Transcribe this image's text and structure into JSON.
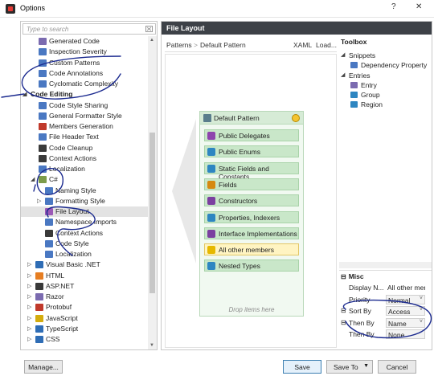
{
  "window": {
    "title": "Options",
    "help_btn": "?",
    "close_btn": "✕"
  },
  "search": {
    "placeholder": "Type to search"
  },
  "tree": [
    {
      "label": "Generated Code",
      "color": "#7b6bb0"
    },
    {
      "label": "Inspection Severity",
      "color": "#4a78c2"
    },
    {
      "label": "Custom Patterns",
      "color": "#4a78c2"
    },
    {
      "label": "Code Annotations",
      "color": "#4a78c2"
    },
    {
      "label": "Cyclomatic Complexity",
      "color": "#4a78c2"
    },
    {
      "label": "Code Editing",
      "group": true
    },
    {
      "label": "Code Style Sharing",
      "color": "#4a78c2"
    },
    {
      "label": "General Formatter Style",
      "color": "#4a78c2"
    },
    {
      "label": "Members Generation",
      "color": "#c0392b"
    },
    {
      "label": "File Header Text",
      "color": "#4a78c2"
    },
    {
      "label": "Code Cleanup",
      "color": "#3a3a3a"
    },
    {
      "label": "Context Actions",
      "color": "#3a3a3a"
    },
    {
      "label": "Localization",
      "color": "#4a78c2"
    },
    {
      "label": "C#",
      "color": "#7d9c4a",
      "expanded": true
    },
    {
      "label": "Naming Style",
      "color": "#4a78c2"
    },
    {
      "label": "Formatting Style",
      "color": "#4a78c2",
      "collapsed": true
    },
    {
      "label": "File Layout",
      "color": "#9b59b6",
      "selected": true
    },
    {
      "label": "Namespace Imports",
      "color": "#4a78c2"
    },
    {
      "label": "Context Actions",
      "color": "#3a3a3a"
    },
    {
      "label": "Code Style",
      "color": "#4a78c2"
    },
    {
      "label": "Localization",
      "color": "#4a78c2"
    },
    {
      "label": "Visual Basic .NET",
      "color": "#2f6db5",
      "collapsed": true
    },
    {
      "label": "HTML",
      "color": "#e67e22",
      "collapsed": true
    },
    {
      "label": "ASP.NET",
      "color": "#3a3a3a",
      "collapsed": true
    },
    {
      "label": "Razor",
      "color": "#7b6bb0",
      "collapsed": true
    },
    {
      "label": "Protobuf",
      "color": "#c0392b",
      "collapsed": true
    },
    {
      "label": "JavaScript",
      "color": "#d4ac0d",
      "collapsed": true
    },
    {
      "label": "TypeScript",
      "color": "#2f6db5",
      "collapsed": true
    },
    {
      "label": "CSS",
      "color": "#2f6db5",
      "collapsed": true
    }
  ],
  "file_layout": {
    "header": "File Layout",
    "breadcrumbs": [
      "Patterns",
      ">",
      "Default Pattern",
      "XAML",
      "Load..."
    ],
    "pattern_title": "Default Pattern",
    "items": [
      {
        "label": "Public Delegates",
        "color": "#8e44ad"
      },
      {
        "label": "Public Enums",
        "color": "#2e86c1"
      },
      {
        "label": "Static Fields and Constants",
        "color": "#2e86c1"
      },
      {
        "label": "Fields",
        "color": "#d68910"
      },
      {
        "label": "Constructors",
        "color": "#7b3fa0"
      },
      {
        "label": "Properties, Indexers",
        "color": "#2e86c1"
      },
      {
        "label": "Interface Implementations",
        "color": "#7b3fa0"
      },
      {
        "label": "All other members",
        "color": "#e6b800",
        "highlight": true
      },
      {
        "label": "Nested Types",
        "color": "#2e86c1"
      }
    ],
    "drop_hint": "Drop items here"
  },
  "toolbox": {
    "title": "Toolbox",
    "snippets_label": "Snippets",
    "snippets": [
      {
        "label": "Dependency Property"
      }
    ],
    "entries_label": "Entries",
    "entries": [
      {
        "label": "Entry"
      },
      {
        "label": "Group"
      },
      {
        "label": "Region"
      }
    ]
  },
  "misc": {
    "section": "Misc",
    "rows": [
      {
        "key": "Display N...",
        "value": "All other mem",
        "plain": true
      },
      {
        "key": "Priority",
        "value": "Normal"
      },
      {
        "key": "Sort By",
        "value": "Access",
        "expander": true
      },
      {
        "key": "Then By",
        "value": "Name",
        "expander": true
      },
      {
        "key": "Then By",
        "value": "None"
      }
    ]
  },
  "footer": {
    "manage": "Manage...",
    "save": "Save",
    "save_to": "Save To",
    "cancel": "Cancel"
  }
}
